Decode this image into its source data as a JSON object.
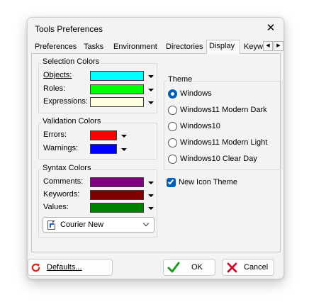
{
  "window": {
    "title": "Tools Preferences",
    "close_glyph": "✕"
  },
  "tabs": {
    "items": [
      "Preferences",
      "Tasks",
      "Environment",
      "Directories",
      "Display",
      "Keyw"
    ],
    "active_index": 4,
    "scroll_left": "◀",
    "scroll_right": "▶"
  },
  "selection_colors": {
    "title": "Selection Colors",
    "rows": [
      {
        "label": "Objects:",
        "color": "#00ffff"
      },
      {
        "label": "Roles:",
        "color": "#00ff00"
      },
      {
        "label": "Expressions:",
        "color": "#ffffe1"
      }
    ]
  },
  "validation_colors": {
    "title": "Validation Colors",
    "rows": [
      {
        "label": "Errors:",
        "color": "#ff0000"
      },
      {
        "label": "Warnings:",
        "color": "#0000ff"
      }
    ]
  },
  "syntax_colors": {
    "title": "Syntax Colors",
    "rows": [
      {
        "label": "Comments:",
        "color": "#800080"
      },
      {
        "label": "Keywords:",
        "color": "#800000"
      },
      {
        "label": "Values:",
        "color": "#008000"
      }
    ],
    "font": {
      "value": "Courier New",
      "icon": "font-file-icon"
    }
  },
  "theme": {
    "title": "Theme",
    "options": [
      "Windows",
      "Windows11 Modern Dark",
      "Windows10",
      "Windows11 Modern Light",
      "Windows10 Clear Day"
    ],
    "selected_index": 0
  },
  "new_icon_theme": {
    "label": "New Icon Theme",
    "checked": true
  },
  "buttons": {
    "defaults": {
      "label": "Defaults...",
      "icon": "refresh-icon"
    },
    "ok": {
      "label": "OK",
      "icon": "checkmark-icon"
    },
    "cancel": {
      "label": "Cancel",
      "icon": "x-icon"
    }
  },
  "colors": {
    "accent": "#005fb8",
    "window_bg": "#f3f3f3",
    "ok_green": "#1e9e1e",
    "cancel_red": "#c8102e",
    "defaults_red": "#d42a1f"
  }
}
